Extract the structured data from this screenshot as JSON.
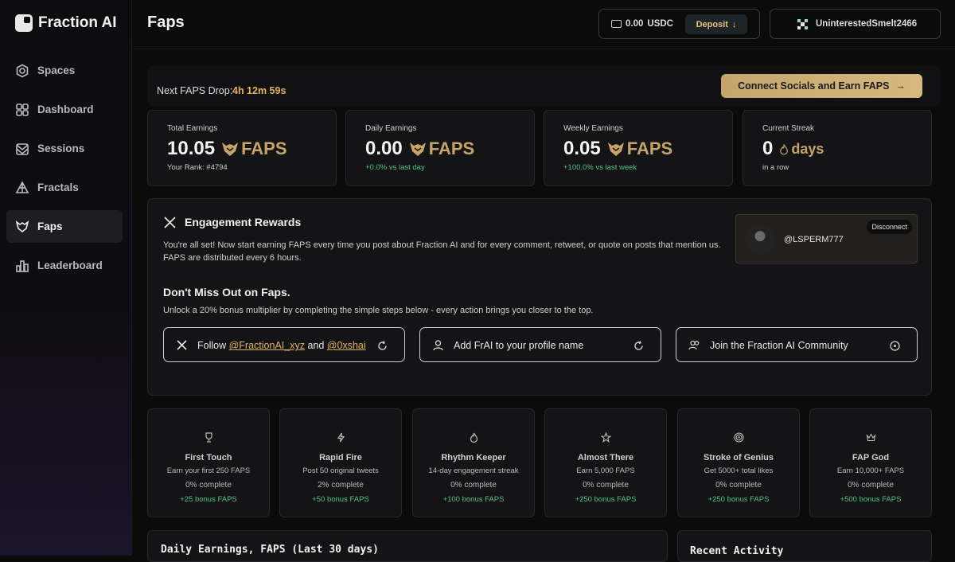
{
  "app": {
    "name": "Fraction AI"
  },
  "sidebar": {
    "items": [
      {
        "label": "Spaces",
        "icon": "spaces-icon"
      },
      {
        "label": "Dashboard",
        "icon": "dashboard-icon"
      },
      {
        "label": "Sessions",
        "icon": "sessions-icon"
      },
      {
        "label": "Fractals",
        "icon": "fractals-icon"
      },
      {
        "label": "Faps",
        "icon": "faps-icon",
        "active": true
      },
      {
        "label": "Leaderboard",
        "icon": "leaderboard-icon"
      }
    ]
  },
  "header": {
    "title": "Faps",
    "wallet_amount": "0.00",
    "wallet_currency": "USDC",
    "deposit_label": "Deposit",
    "deposit_arrow": "↓",
    "username": "UninterestedSmelt2466"
  },
  "drop": {
    "label": "Next FAPS Drop:",
    "time": "4h 12m 59s",
    "connect_label": "Connect Socials and Earn FAPS",
    "connect_arrow": "→"
  },
  "stats": {
    "total": {
      "label": "Total Earnings",
      "value": "10.05",
      "unit": "FAPS",
      "sub": "Your Rank: #4794"
    },
    "daily": {
      "label": "Daily Earnings",
      "value": "0.00",
      "unit": "FAPS",
      "sub": "+0.0% vs last day"
    },
    "weekly": {
      "label": "Weekly Earnings",
      "value": "0.05",
      "unit": "FAPS",
      "sub": "+100.0% vs last week"
    },
    "streak": {
      "label": "Current Streak",
      "value": "0",
      "unit": "days",
      "sub": "in a row"
    }
  },
  "engagement": {
    "title": "Engagement Rewards",
    "desc": "You're all set! Now start earning FAPS every time you post about Fraction AI and for every comment, retweet, or quote on posts that mention us. FAPS are distributed every 6 hours.",
    "handle": "@LSPERM777",
    "disconnect_label": "Disconnect",
    "miss_title": "Don't Miss Out on Faps.",
    "miss_desc": "Unlock a 20% bonus multiplier by completing the simple steps below - every action brings you closer to the top.",
    "tasks": {
      "follow_prefix": "Follow",
      "follow_link1": "@FractionAI_xyz",
      "follow_and": "and",
      "follow_link2": "@0xshai",
      "profile": "Add FrAI to your profile name",
      "community": "Join the Fraction AI Community"
    }
  },
  "achievements": [
    {
      "name": "First Touch",
      "desc": "Earn your first 250 FAPS",
      "pct": "0% complete",
      "bonus": "+25 bonus FAPS",
      "icon": "trophy-icon"
    },
    {
      "name": "Rapid Fire",
      "desc": "Post 50 original tweets",
      "pct": "2% complete",
      "bonus": "+50 bonus FAPS",
      "icon": "lightning-icon"
    },
    {
      "name": "Rhythm Keeper",
      "desc": "14-day engagement streak",
      "pct": "0% complete",
      "bonus": "+100 bonus FAPS",
      "icon": "flame-icon"
    },
    {
      "name": "Almost There",
      "desc": "Earn 5,000 FAPS",
      "pct": "0% complete",
      "bonus": "+250 bonus FAPS",
      "icon": "star-icon"
    },
    {
      "name": "Stroke of Genius",
      "desc": "Get 5000+ total likes",
      "pct": "0% complete",
      "bonus": "+250 bonus FAPS",
      "icon": "target-icon"
    },
    {
      "name": "FAP God",
      "desc": "Earn 10,000+ FAPS",
      "pct": "0% complete",
      "bonus": "+500 bonus FAPS",
      "icon": "crown-icon"
    }
  ],
  "panels": {
    "chart_title": "Daily Earnings, FAPS (Last 30 days)",
    "activity_title": "Recent Activity"
  }
}
